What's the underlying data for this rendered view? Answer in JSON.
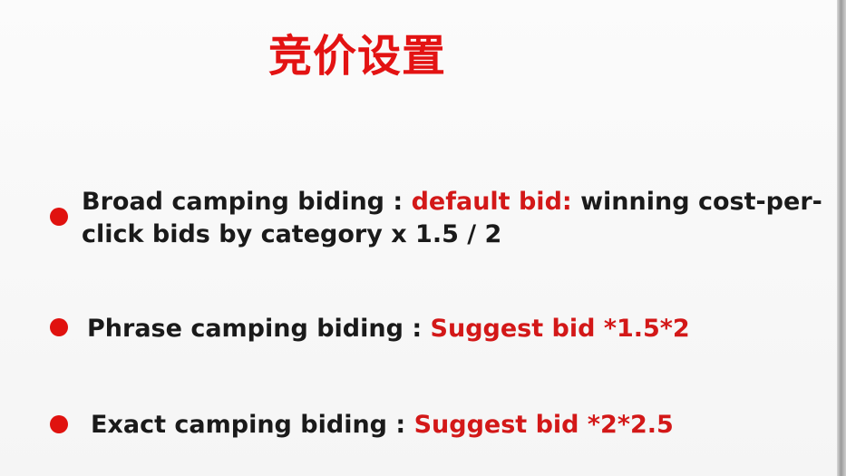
{
  "slide": {
    "title": "竞价设置",
    "bullets": [
      {
        "label": "Broad camping biding : ",
        "highlight": "default bid:",
        "rest": " winning cost-per-click bids by category x 1.5 / 2"
      },
      {
        "label": "Phrase camping biding : ",
        "highlight": "Suggest bid *1.5*2"
      },
      {
        "label": "Exact camping biding : ",
        "highlight": "Suggest bid *2*2.5"
      }
    ]
  },
  "colors": {
    "title": "#e31313",
    "highlight": "#d31818",
    "bullet_dot": "#e0120f",
    "text": "#1a1a1a"
  }
}
